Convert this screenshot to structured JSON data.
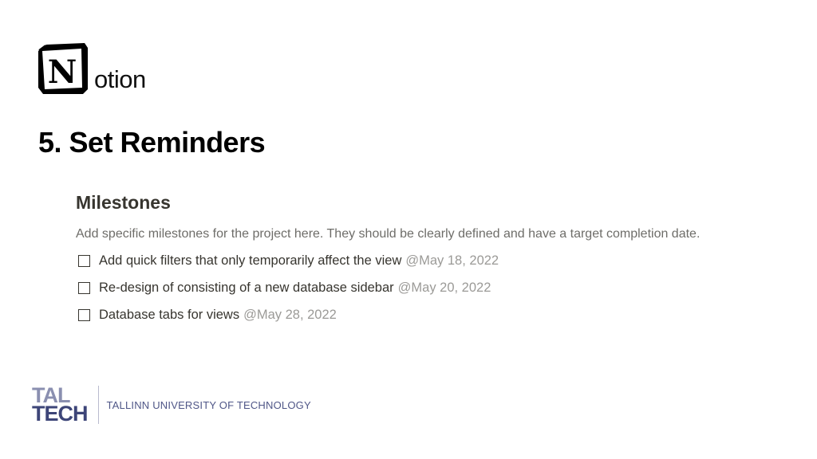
{
  "logo": {
    "icon_letter": "N",
    "wordmark": "otion"
  },
  "slide": {
    "title": "5. Set Reminders"
  },
  "milestones": {
    "heading": "Milestones",
    "description": "Add specific milestones for the project here. They should be clearly defined and have a target completion date.",
    "items": [
      {
        "text": "Add quick filters that only temporarily affect the view",
        "date": "@May 18, 2022",
        "checked": false
      },
      {
        "text": "Re-design of consisting of a new database sidebar",
        "date": "@May 20, 2022",
        "checked": false
      },
      {
        "text": "Database tabs for views",
        "date": "@May 28, 2022",
        "checked": false
      }
    ]
  },
  "footer": {
    "logo_line1": "TAL",
    "logo_line2": "TECH",
    "university_name": "TALLINN UNIVERSITY OF TECHNOLOGY"
  },
  "colors": {
    "text_primary": "#37352f",
    "text_muted": "#9b9a97",
    "taltech_light": "#8a8fb0",
    "taltech_dark": "#3d4578"
  },
  "icons": [
    "notion-logo-icon",
    "checkbox-icon"
  ]
}
